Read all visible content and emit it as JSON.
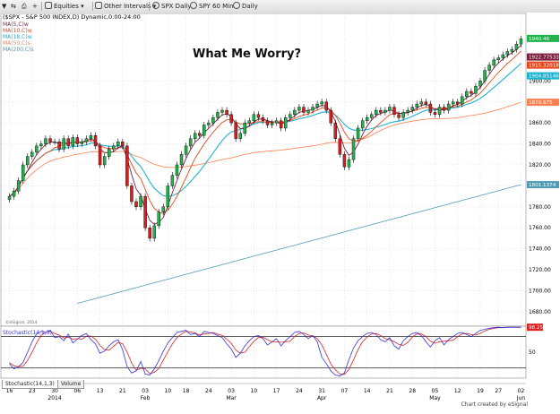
{
  "toolbar": {
    "symbol_label": "Equities",
    "intervals_label": "Other Intervals",
    "spx_daily_label": "SPX Daily",
    "spy60_label": "SPY 60 Min",
    "daily_label": "Daily"
  },
  "legend": {
    "header": "($SPX - S&P 500 INDEX,D) Dynamic,0:00-24:00",
    "ma1": "MA(5,C)w",
    "ma2": "MA(10,C)w",
    "ma3": "MA(18,C)w",
    "ma4": "MA(50,C)s",
    "ma5": "MA(200,C)s"
  },
  "colors": {
    "ma5": "#7a1f3d",
    "ma10": "#e8471c",
    "ma18": "#1bb3d0",
    "ma50": "#ff7f50",
    "ma200": "#4f9bb5",
    "up": "#22b34a",
    "down": "#d81e1e",
    "stoch_k": "#3333dd",
    "stoch_d": "#dd2222"
  },
  "annotation": "What Me Worry?",
  "watermark": "©eSignal, 2014",
  "tabs": [
    "Stochastic(14,1,3)",
    "Volume"
  ],
  "footer": "Chart created by eSignal",
  "chart_data": {
    "type": "candlestick",
    "price_axis": {
      "ylim": [
        1668,
        1960
      ],
      "ticks": [
        1680,
        1700,
        1720,
        1740,
        1760,
        1780,
        1800,
        1820,
        1840,
        1860,
        1880,
        1900
      ],
      "tick_labels": [
        "1680.00",
        "1700.00",
        "1720.00",
        "1740.00",
        "1760.00",
        "1780.00",
        "1800.00",
        "1820.00",
        "1840.00",
        "1860.00",
        "1880.00",
        "1900.00"
      ]
    },
    "x_ticks": [
      "16",
      "23",
      "30",
      "06",
      "13",
      "21",
      "03",
      "10",
      "18",
      "24",
      "03",
      "10",
      "17",
      "24",
      "31",
      "07",
      "14",
      "21",
      "28",
      "05",
      "12",
      "19",
      "27",
      "02"
    ],
    "x_tick_idx": [
      0,
      5,
      10,
      15,
      20,
      25,
      30,
      35,
      39,
      44,
      49,
      54,
      59,
      64,
      69,
      74,
      79,
      84,
      89,
      94,
      99,
      104,
      108,
      113
    ],
    "month_labels": [
      "2014",
      "Feb",
      "Mar",
      "Apr",
      "May",
      "Jun"
    ],
    "month_idx": [
      10,
      30,
      49,
      69,
      94,
      113
    ],
    "closes": [
      1790,
      1795,
      1805,
      1820,
      1828,
      1832,
      1838,
      1840,
      1845,
      1842,
      1842,
      1835,
      1845,
      1838,
      1846,
      1840,
      1842,
      1845,
      1848,
      1838,
      1820,
      1828,
      1835,
      1838,
      1842,
      1838,
      1800,
      1785,
      1780,
      1790,
      1760,
      1750,
      1762,
      1775,
      1780,
      1800,
      1810,
      1820,
      1830,
      1838,
      1845,
      1850,
      1848,
      1858,
      1860,
      1865,
      1870,
      1872,
      1868,
      1860,
      1845,
      1850,
      1860,
      1862,
      1868,
      1865,
      1862,
      1858,
      1860,
      1862,
      1855,
      1865,
      1868,
      1872,
      1875,
      1870,
      1872,
      1875,
      1878,
      1880,
      1872,
      1860,
      1845,
      1830,
      1818,
      1825,
      1845,
      1855,
      1862,
      1865,
      1868,
      1872,
      1870,
      1872,
      1875,
      1868,
      1865,
      1870,
      1872,
      1875,
      1878,
      1880,
      1878,
      1870,
      1868,
      1875,
      1872,
      1878,
      1880,
      1878,
      1885,
      1890,
      1888,
      1895,
      1900,
      1910,
      1915,
      1920,
      1922,
      1925,
      1928,
      1930,
      1935,
      1940
    ],
    "last_values": [
      {
        "label": "1940.46",
        "value": 1940.46,
        "color": "#22b34a"
      },
      {
        "label": "1922.77533",
        "value": 1922.77533,
        "color": "#7a1f3d"
      },
      {
        "label": "1915.32018",
        "value": 1915.32018,
        "color": "#e8471c"
      },
      {
        "label": "1904.85146",
        "value": 1904.85146,
        "color": "#1bb3d0"
      },
      {
        "label": "1879.675",
        "value": 1879.675,
        "color": "#ff7f50"
      },
      {
        "label": "1801.1374",
        "value": 1801.1374,
        "color": "#4f9bb5"
      }
    ],
    "ma200_line": {
      "start_value": 1688,
      "end_value": 1801.1374
    },
    "stochastic": {
      "ylim": [
        0,
        100
      ],
      "ticks": [
        50
      ],
      "tick_labels": [
        "50"
      ],
      "levels": [
        80,
        20
      ],
      "last_value_label": "98.25",
      "k_values": [
        28,
        18,
        22,
        30,
        50,
        70,
        85,
        90,
        88,
        92,
        78,
        80,
        72,
        85,
        68,
        75,
        82,
        86,
        74,
        66,
        48,
        52,
        62,
        70,
        74,
        55,
        22,
        10,
        14,
        32,
        8,
        6,
        18,
        34,
        52,
        68,
        78,
        88,
        90,
        92,
        84,
        86,
        80,
        90,
        88,
        86,
        82,
        78,
        66,
        56,
        40,
        48,
        62,
        72,
        80,
        82,
        76,
        64,
        70,
        76,
        62,
        72,
        80,
        88,
        90,
        84,
        76,
        82,
        70,
        40,
        28,
        14,
        6,
        4,
        10,
        36,
        58,
        72,
        80,
        86,
        88,
        84,
        74,
        70,
        78,
        62,
        56,
        72,
        80,
        86,
        88,
        82,
        70,
        60,
        72,
        78,
        64,
        74,
        80,
        86,
        88,
        84,
        80,
        86,
        92,
        94,
        96,
        97,
        98,
        97,
        98,
        98,
        98,
        98
      ],
      "d_values": [
        30,
        24,
        22,
        23,
        34,
        50,
        68,
        82,
        88,
        90,
        86,
        83,
        77,
        79,
        75,
        76,
        75,
        81,
        81,
        75,
        63,
        55,
        54,
        61,
        69,
        66,
        50,
        29,
        15,
        19,
        18,
        9,
        11,
        19,
        35,
        51,
        66,
        78,
        85,
        90,
        89,
        87,
        83,
        85,
        86,
        88,
        85,
        82,
        75,
        67,
        54,
        48,
        50,
        61,
        71,
        78,
        79,
        74,
        70,
        70,
        69,
        70,
        71,
        80,
        86,
        87,
        83,
        81,
        76,
        64,
        46,
        27,
        16,
        8,
        7,
        17,
        35,
        55,
        70,
        79,
        85,
        86,
        82,
        76,
        74,
        70,
        65,
        63,
        69,
        79,
        85,
        85,
        80,
        71,
        67,
        70,
        71,
        72,
        73,
        80,
        85,
        86,
        84,
        83,
        86,
        91,
        94,
        96,
        97,
        97,
        98,
        98,
        98,
        98
      ]
    }
  }
}
